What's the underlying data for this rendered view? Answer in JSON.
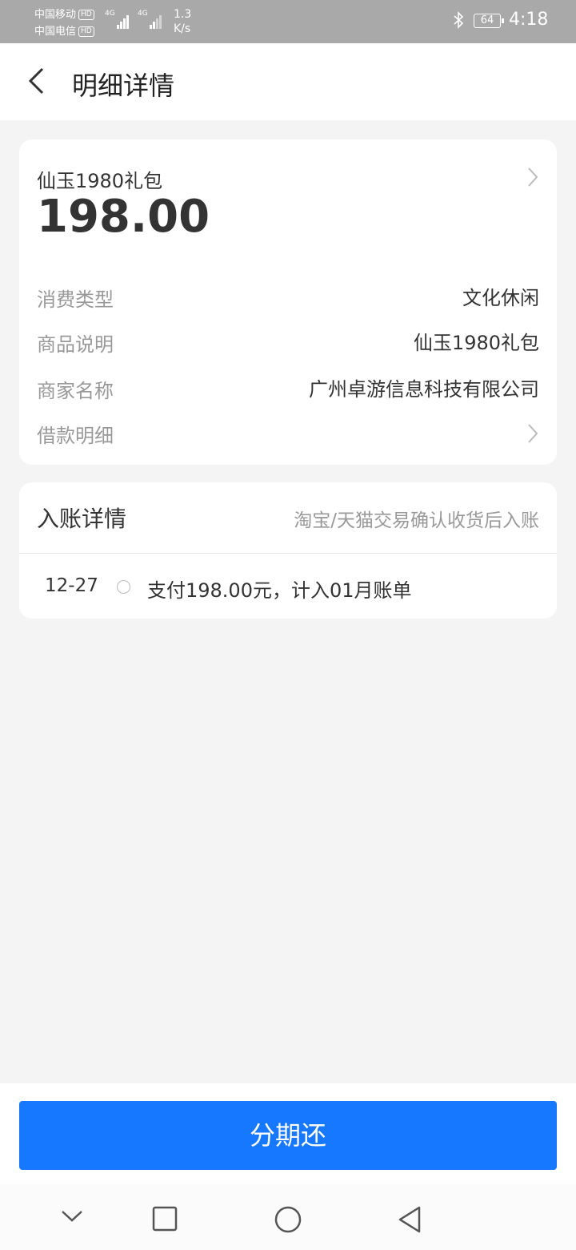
{
  "status_bar": {
    "carrier1": "中国移动",
    "carrier2": "中国电信",
    "hd": "HD",
    "network": "4G",
    "speed_value": "1.3",
    "speed_unit": "K/s",
    "battery": "64",
    "time": "4:18"
  },
  "header": {
    "title": "明细详情"
  },
  "summary": {
    "product": "仙玉1980礼包",
    "amount": "198.00",
    "rows": [
      {
        "label": "消费类型",
        "value": "文化休闲"
      },
      {
        "label": "商品说明",
        "value": "仙玉1980礼包"
      },
      {
        "label": "商家名称",
        "value": "广州卓游信息科技有限公司"
      },
      {
        "label": "借款明细",
        "value": ""
      }
    ]
  },
  "entry": {
    "title": "入账详情",
    "note": "淘宝/天猫交易确认收货后入账",
    "items": [
      {
        "date": "12-27",
        "desc": "支付198.00元，计入01月账单"
      }
    ]
  },
  "action": {
    "label": "分期还"
  },
  "system_nav": [
    "chevron-down-icon",
    "square-icon",
    "circle-icon",
    "triangle-back-icon"
  ]
}
